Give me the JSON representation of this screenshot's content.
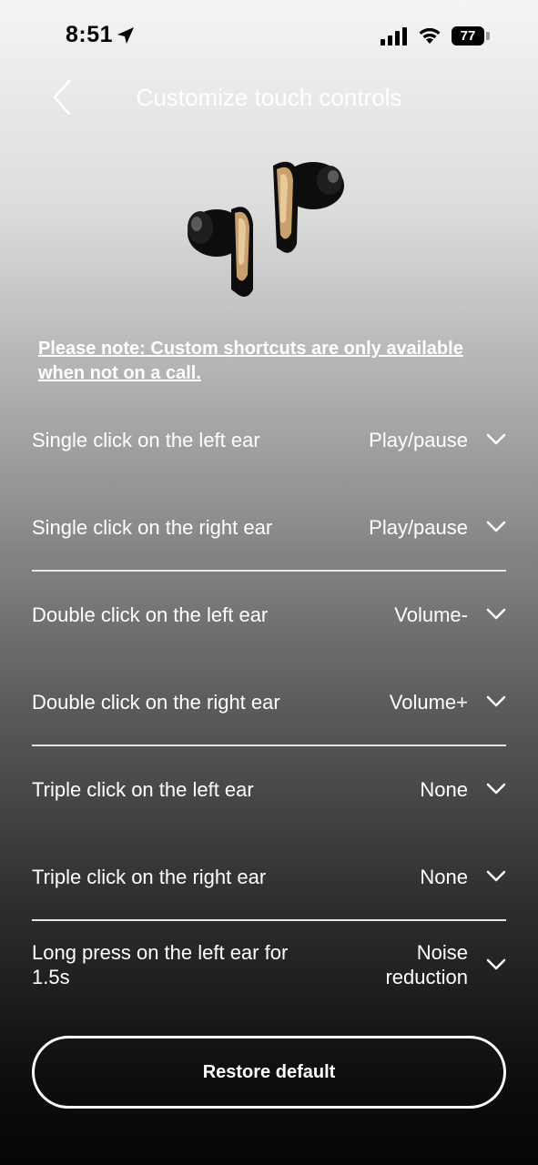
{
  "status_bar": {
    "time": "8:51",
    "battery": "77",
    "battery_fraction": 0.77,
    "icons": [
      "location-arrow-icon",
      "cellular-signal-icon",
      "wifi-icon",
      "battery-icon"
    ]
  },
  "header": {
    "title": "Customize touch controls",
    "back_icon": "chevron-left-icon"
  },
  "note": "Please note: Custom shortcuts are only available when not on a call.",
  "controls": [
    {
      "label": "Single click on the left ear",
      "value": "Play/pause"
    },
    {
      "label": "Single click on the right ear",
      "value": "Play/pause"
    },
    {
      "label": "Double click on the left ear",
      "value": "Volume-"
    },
    {
      "label": "Double click on the right ear",
      "value": "Volume+"
    },
    {
      "label": "Triple click on the left ear",
      "value": "None"
    },
    {
      "label": "Triple click on the right ear",
      "value": "None"
    },
    {
      "label": "Long press on the left ear for 1.5s",
      "value": "Noise reduction"
    }
  ],
  "restore_button": "Restore default",
  "colors": {
    "accent_gold": "#c9a06c",
    "earbud_black": "#0d0d0d",
    "text": "#ffffff"
  }
}
